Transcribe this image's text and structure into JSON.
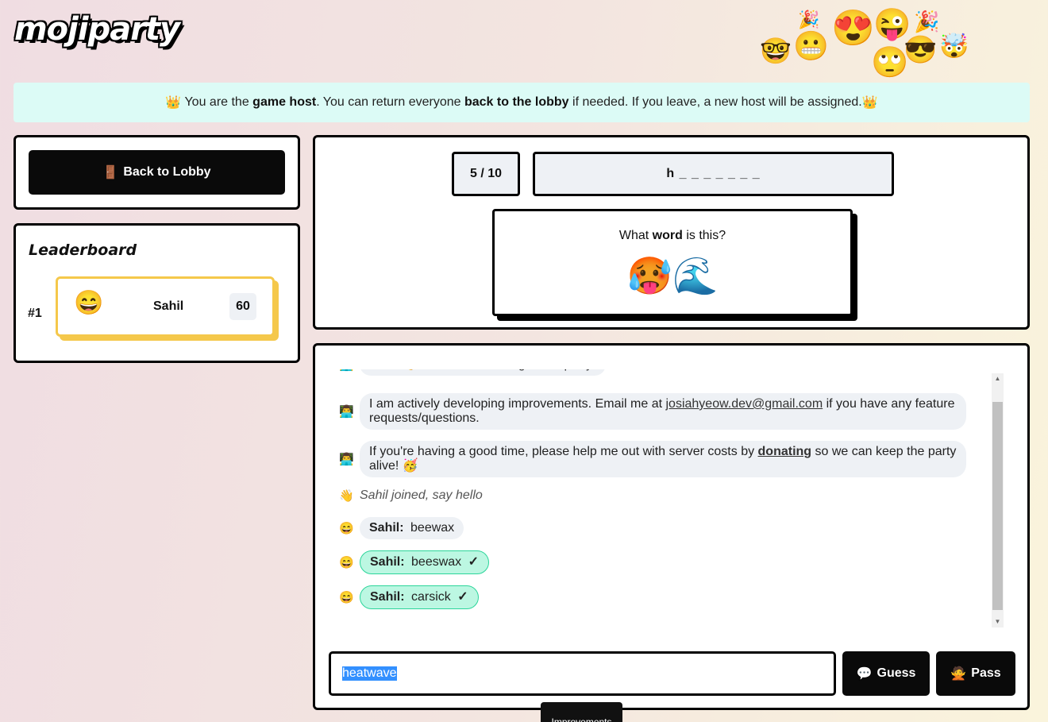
{
  "header": {
    "logo_text": "mojiparty",
    "emoji_cloud": [
      "🥳",
      "😍",
      "🎉",
      "😜",
      "🎉",
      "🤓",
      "😬",
      "🙄",
      "😎",
      "🤯"
    ]
  },
  "banner": {
    "icon": "👑",
    "pre": " You are the ",
    "host": "game host",
    "mid": ". You can return everyone ",
    "lobby": "back to the lobby",
    "post": " if needed. If you leave, a new host will be assigned.",
    "icon_end": "👑"
  },
  "lobby_button": {
    "icon": "🚪",
    "label": "Back to Lobby"
  },
  "leaderboard": {
    "title": "Leaderboard",
    "entries": [
      {
        "rank": "#1",
        "emoji": "😄",
        "name": "Sahil",
        "score": "60"
      }
    ]
  },
  "game": {
    "round": "5 / 10",
    "hint": "h _ _ _ _ _ _ _",
    "question_pre": "What ",
    "question_word": "word",
    "question_post": " is this?",
    "emojis": "🥵🌊"
  },
  "chat": {
    "messages": [
      {
        "avatar": "👨‍💻",
        "text": "Hello 👋 Thanks for coming to the party!"
      },
      {
        "avatar": "👨‍💻",
        "text_pre": "I am actively developing improvements. Email me at ",
        "email": "josiahyeow.dev@gmail.com",
        "text_post": " if you have any feature requests/questions."
      },
      {
        "avatar": "👨‍💻",
        "text_pre": "If you're having a good time, please help me out with server costs by ",
        "link": "donating",
        "text_post": " so we can keep the party alive! 🥳"
      },
      {
        "avatar": "👋",
        "system": "Sahil joined, say hello"
      },
      {
        "avatar": "😄",
        "name": "Sahil:",
        "guess": "beewax",
        "correct": false
      },
      {
        "avatar": "😄",
        "name": "Sahil:",
        "guess": "beeswax",
        "correct": true
      },
      {
        "avatar": "😄",
        "name": "Sahil:",
        "guess": "carsick",
        "correct": true
      }
    ],
    "check_mark": "✓"
  },
  "input": {
    "value": "heatwave"
  },
  "buttons": {
    "guess_icon": "💬",
    "guess_label": "Guess",
    "pass_icon": "🙅",
    "pass_label": "Pass"
  },
  "tooltip": {
    "text": "Improvements"
  }
}
